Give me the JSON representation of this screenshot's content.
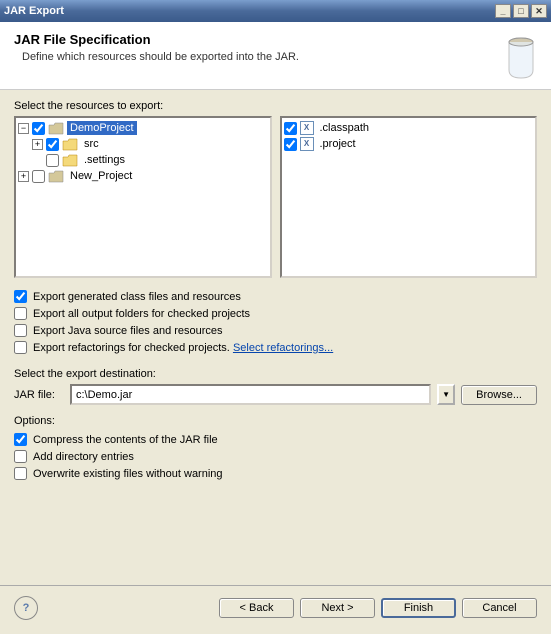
{
  "window": {
    "title": "JAR Export"
  },
  "header": {
    "title": "JAR File Specification",
    "desc": "Define which resources should be exported into the JAR."
  },
  "tree": {
    "label": "Select the resources to export:",
    "items": [
      {
        "name": "DemoProject",
        "checked": true,
        "expanded": true,
        "selected": true,
        "type": "proj"
      },
      {
        "name": "src",
        "checked": true,
        "expanded": false,
        "indent": 1,
        "type": "folder"
      },
      {
        "name": ".settings",
        "checked": false,
        "expanded": false,
        "indent": 1,
        "type": "folder"
      },
      {
        "name": "New_Project",
        "checked": false,
        "expanded": false,
        "indent": 0,
        "type": "proj"
      }
    ],
    "files": [
      {
        "name": ".classpath",
        "checked": true
      },
      {
        "name": ".project",
        "checked": true
      }
    ]
  },
  "exportOpts": [
    {
      "label": "Export generated class files and resources",
      "checked": true
    },
    {
      "label": "Export all output folders for checked projects",
      "checked": false
    },
    {
      "label": "Export Java source files and resources",
      "checked": false
    },
    {
      "label": "Export refactorings for checked projects.",
      "checked": false,
      "link": "Select refactorings..."
    }
  ],
  "dest": {
    "label": "Select the export destination:",
    "fieldLabel": "JAR file:",
    "value": "c:\\Demo.jar",
    "browse": "Browse..."
  },
  "options": {
    "label": "Options:",
    "items": [
      {
        "label": "Compress the contents of the JAR file",
        "checked": true
      },
      {
        "label": "Add directory entries",
        "checked": false
      },
      {
        "label": "Overwrite existing files without warning",
        "checked": false
      }
    ]
  },
  "footer": {
    "back": "< Back",
    "next": "Next >",
    "finish": "Finish",
    "cancel": "Cancel"
  }
}
